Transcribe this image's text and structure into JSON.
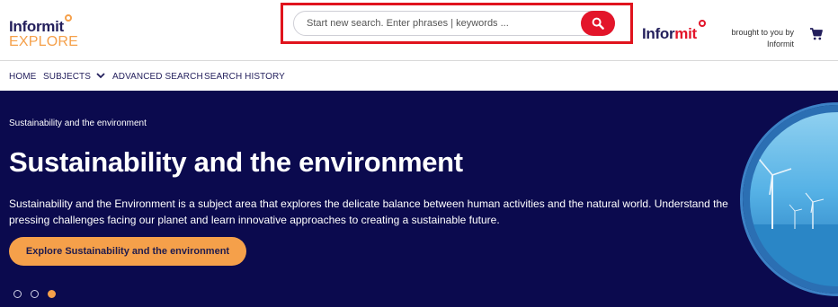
{
  "header": {
    "logo": {
      "line1": "Informit",
      "line2": "EXPLORE"
    },
    "search": {
      "placeholder": "Start new search. Enter phrases | keywords ..."
    },
    "brand": {
      "part1": "Infor",
      "part2": "mit"
    },
    "brought_by": "brought to you by Informit"
  },
  "nav": {
    "items": [
      "HOME",
      "SUBJECTS",
      "ADVANCED SEARCH",
      "SEARCH HISTORY"
    ]
  },
  "hero": {
    "breadcrumb": "Sustainability and the environment",
    "title": "Sustainability and the environment",
    "description": "Sustainability and the Environment is a subject area that explores the delicate balance between human activities and the natural world. Understand the pressing challenges facing our planet and learn innovative approaches to creating a sustainable future.",
    "cta_label": "Explore Sustainability and the environment",
    "carousel": {
      "slide_count": 3,
      "active_index": 3
    }
  },
  "colors": {
    "hero_bg": "#0b0a4e",
    "accent_orange": "#f5a04a",
    "brand_red": "#e3152a",
    "navy_text": "#231f5c",
    "highlight_box": "#e0131d"
  },
  "icons": [
    "search-icon",
    "cart-icon",
    "chevron-down-icon",
    "wind-turbine-image"
  ]
}
